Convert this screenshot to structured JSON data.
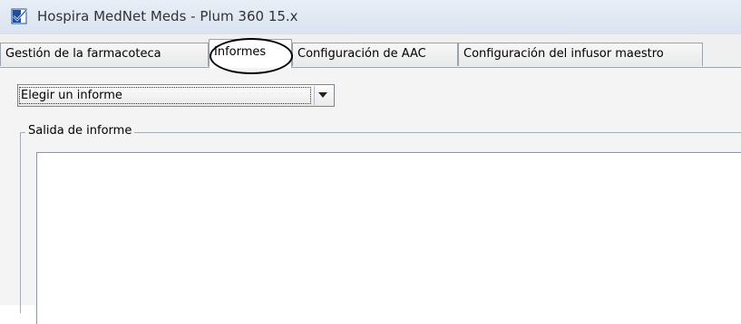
{
  "window": {
    "title": "Hospira MedNet Meds - Plum 360 15.x",
    "app_icon": "document-check-icon"
  },
  "tabs": [
    {
      "label": "Gestión de la farmacoteca",
      "active": false
    },
    {
      "label": "Informes",
      "active": true
    },
    {
      "label": "Configuración de AAC",
      "active": false
    },
    {
      "label": "Configuración del infusor maestro",
      "active": false
    }
  ],
  "report_selector": {
    "value": "Elegir un informe",
    "arrow_icon": "chevron-down-icon"
  },
  "report_output": {
    "legend": "Salida de informe",
    "content": ""
  },
  "colors": {
    "accent": "#1f4e9c",
    "annotation": "#000000"
  }
}
